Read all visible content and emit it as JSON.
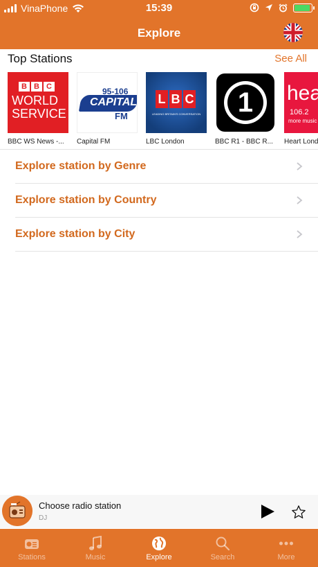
{
  "status_bar": {
    "carrier": "VinaPhone",
    "time": "15:39"
  },
  "nav": {
    "title": "Explore",
    "language_flag": "uk-flag-icon"
  },
  "top_stations": {
    "title": "Top Stations",
    "see_all": "See All",
    "items": [
      {
        "name": "BBC WS News -...",
        "logo_text": "BBC WORLD SERVICE",
        "logo_bbc": "BBC",
        "logo_line1": "WORLD",
        "logo_line2": "SERVICE"
      },
      {
        "name": "Capital FM",
        "logo_num": "95-106",
        "logo_text": "CAPITAL",
        "logo_fm": "FM"
      },
      {
        "name": "LBC London",
        "logo_text": "LBC",
        "logo_tag": "LEADING BRITAIN'S CONVERSATION"
      },
      {
        "name": "BBC R1 - BBC R...",
        "logo_text": "1"
      },
      {
        "name": "Heart London",
        "logo_text": "hea",
        "logo_num": "106.2",
        "logo_tag": "more music"
      }
    ]
  },
  "explore_list": [
    {
      "label": "Explore station by Genre"
    },
    {
      "label": "Explore station by Country"
    },
    {
      "label": "Explore station by City"
    }
  ],
  "player": {
    "title": "Choose radio station",
    "subtitle": "DJ",
    "play_icon": "play-icon",
    "favorite_icon": "star-icon"
  },
  "tabs": [
    {
      "label": "Stations",
      "icon": "radio-icon",
      "active": false
    },
    {
      "label": "Music",
      "icon": "music-note-icon",
      "active": false
    },
    {
      "label": "Explore",
      "icon": "globe-icon",
      "active": true
    },
    {
      "label": "Search",
      "icon": "search-icon",
      "active": false
    },
    {
      "label": "More",
      "icon": "more-icon",
      "active": false
    }
  ],
  "colors": {
    "accent": "#e2742a",
    "row_text": "#d2691e",
    "battery": "#4cd964"
  }
}
